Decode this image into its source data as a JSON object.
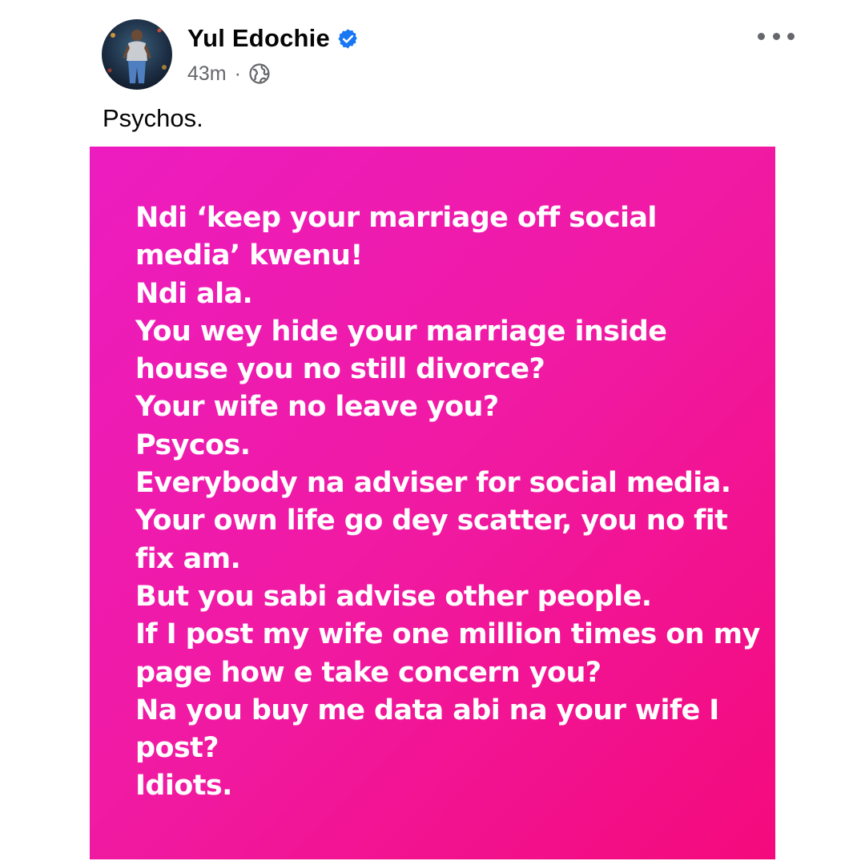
{
  "post": {
    "author": "Yul Edochie",
    "timestamp": "43m",
    "separator": "·",
    "caption": "Psychos.",
    "icons": {
      "verified": "verified-badge-icon",
      "audience": "globe-icon",
      "more": "more-options-icon"
    },
    "colors": {
      "verified": "#1877f2",
      "meta_text": "#65676b",
      "image_gradient_start": "#ec1cc0",
      "image_gradient_end": "#f40a7c"
    }
  },
  "image_text": {
    "lines": [
      "Ndi ‘keep your marriage off social",
      "media’ kwenu!",
      "Ndi ala.",
      "You wey hide your marriage inside",
      "house you no still divorce?",
      "Your wife no leave you?",
      "Psycos.",
      "Everybody na adviser for social media.",
      "Your own life go dey scatter, you no fit",
      "fix am.",
      "But you sabi advise other people.",
      "If I post my wife one million times on my",
      "page how e take concern you?",
      "Na you buy me data abi na your wife I",
      "post?",
      "Idiots."
    ]
  }
}
